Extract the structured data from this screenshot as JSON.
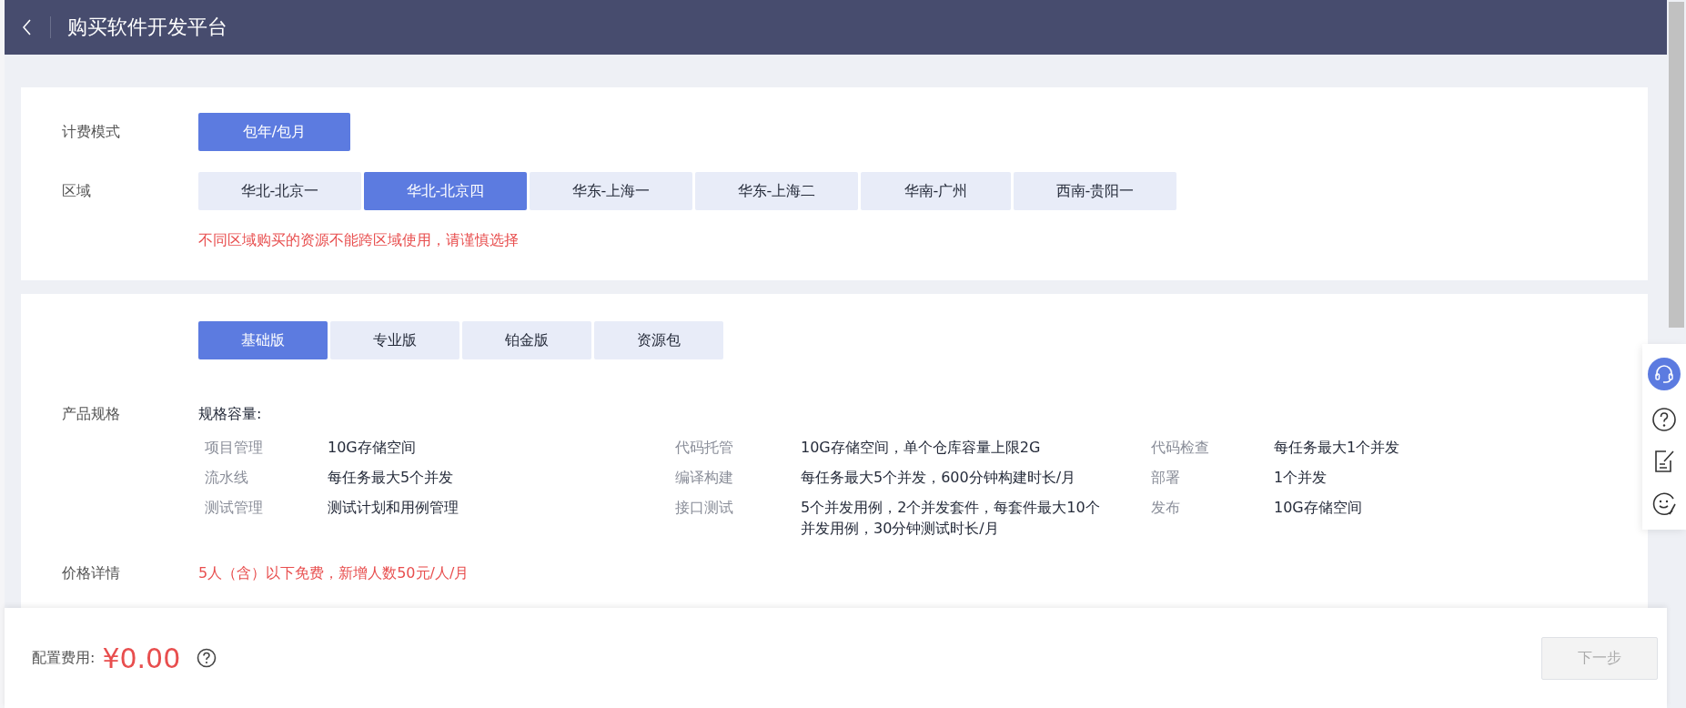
{
  "header": {
    "title": "购买软件开发平台"
  },
  "billing": {
    "label": "计费模式",
    "options": [
      {
        "label": "包年/包月",
        "selected": true
      }
    ]
  },
  "region": {
    "label": "区域",
    "options": [
      {
        "label": "华北-北京一",
        "selected": false
      },
      {
        "label": "华北-北京四",
        "selected": true
      },
      {
        "label": "华东-上海一",
        "selected": false
      },
      {
        "label": "华东-上海二",
        "selected": false
      },
      {
        "label": "华南-广州",
        "selected": false
      },
      {
        "label": "西南-贵阳一",
        "selected": false
      }
    ],
    "warning": "不同区域购买的资源不能跨区域使用，请谨慎选择"
  },
  "editions": [
    {
      "label": "基础版",
      "selected": true
    },
    {
      "label": "专业版",
      "selected": false
    },
    {
      "label": "铂金版",
      "selected": false
    },
    {
      "label": "资源包",
      "selected": false
    }
  ],
  "spec": {
    "label": "产品规格",
    "heading": "规格容量:",
    "items": [
      {
        "name": "项目管理",
        "value": "10G存储空间"
      },
      {
        "name": "代码托管",
        "value": "10G存储空间，单个仓库容量上限2G"
      },
      {
        "name": "代码检查",
        "value": "每任务最大1个并发"
      },
      {
        "name": "流水线",
        "value": "每任务最大5个并发"
      },
      {
        "name": "编译构建",
        "value": "每任务最大5个并发，600分钟构建时长/月"
      },
      {
        "name": "部署",
        "value": "1个并发"
      },
      {
        "name": "测试管理",
        "value": "测试计划和用例管理"
      },
      {
        "name": "接口测试",
        "value": "5个并发用例，2个并发套件，每套件最大10个并发用例，30分钟测试时长/月"
      },
      {
        "name": "发布",
        "value": "10G存储空间"
      }
    ]
  },
  "price": {
    "label": "价格详情",
    "text": "5人（含）以下免费，新增人数50元/人/月"
  },
  "footer": {
    "fee_label": "配置费用:",
    "fee": "¥0.00",
    "next": {
      "label": "下一步",
      "disabled": true
    }
  }
}
